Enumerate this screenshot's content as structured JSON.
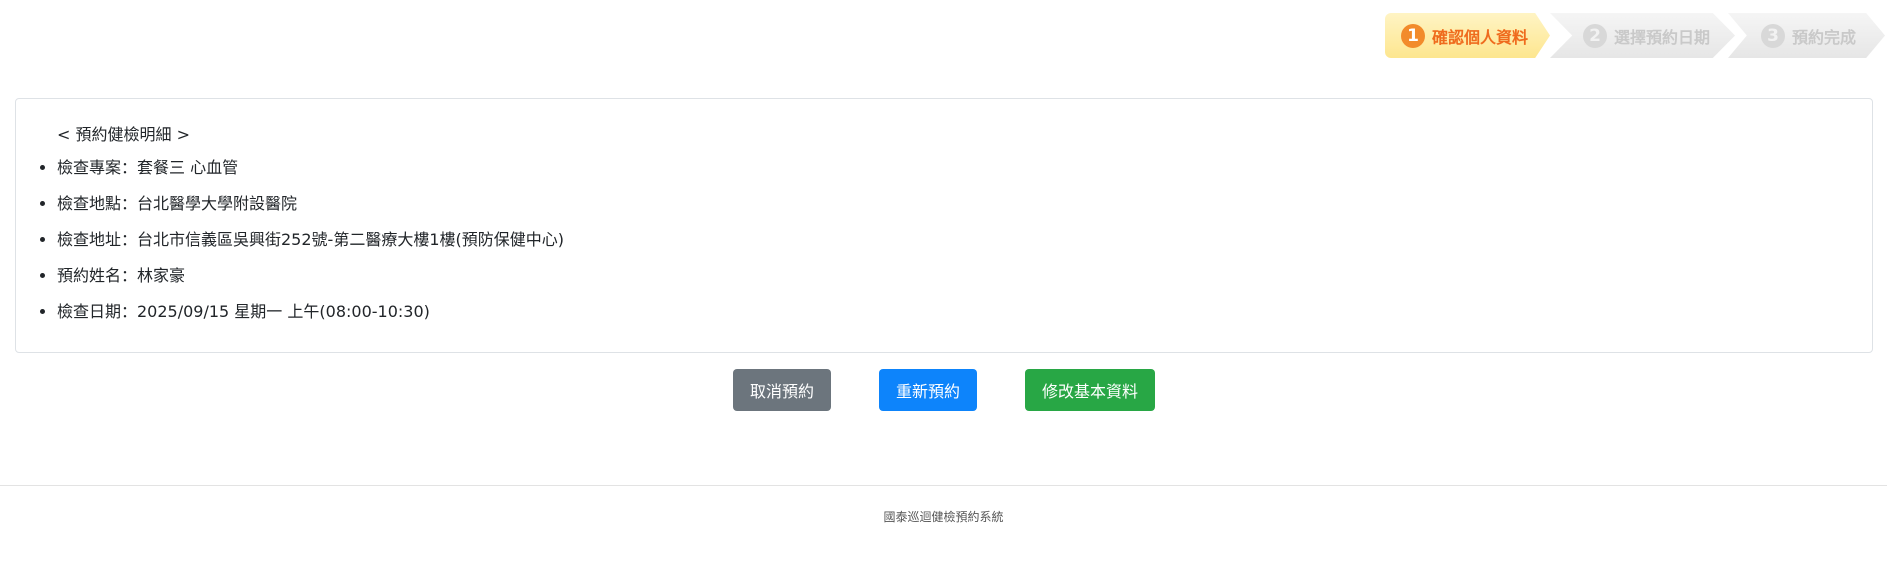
{
  "steps": [
    {
      "number": "1",
      "label": "確認個人資料",
      "active": true
    },
    {
      "number": "2",
      "label": "選擇預約日期",
      "active": false
    },
    {
      "number": "3",
      "label": "預約完成",
      "active": false
    }
  ],
  "detail": {
    "title": "< 預約健檢明細 >",
    "items": [
      "檢查專案：套餐三 心血管",
      "檢查地點：台北醫學大學附設醫院",
      "檢查地址：台北市信義區吳興街252號-第二醫療大樓1樓(預防保健中心)",
      "預約姓名：林家豪",
      "檢查日期：2025/09/15 星期一 上午(08:00-10:30)"
    ]
  },
  "buttons": {
    "cancel": "取消預約",
    "rebook": "重新預約",
    "edit": "修改基本資料"
  },
  "footer": {
    "text": "國泰巡迴健檢預約系統"
  },
  "colors": {
    "cancel_button": "#6c757d",
    "rebook_button": "#0d84fb",
    "edit_button": "#28a745",
    "active_step_text": "#ef6b1d",
    "inactive_step_text": "#c9c9c9"
  }
}
